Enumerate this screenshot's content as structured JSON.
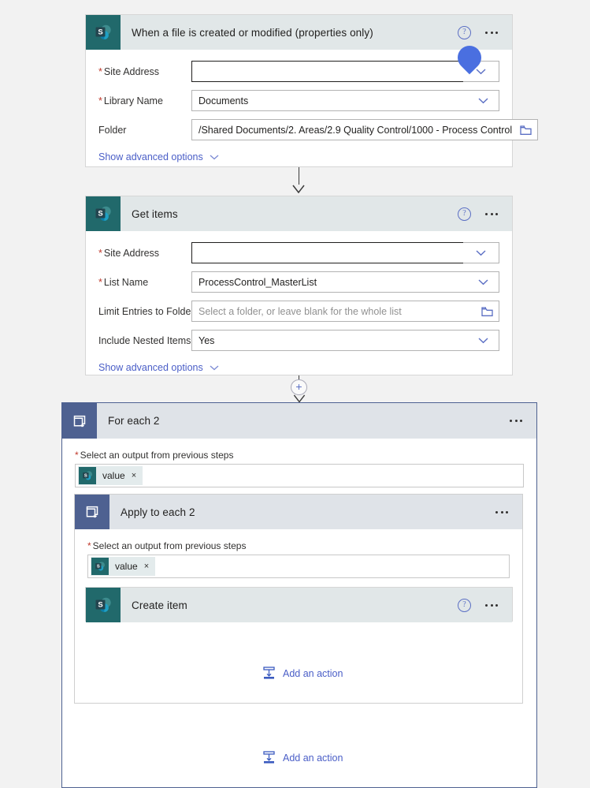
{
  "colors": {
    "page_bg": "#f2f2f2",
    "sharepoint_teal": "#21696b",
    "loop_slate": "#4e6191",
    "link_blue": "#4a5ec7",
    "required_red": "#c0392b",
    "cursor_blue": "#4a6fe0",
    "header_gray": "#dfe3e8"
  },
  "trigger_card": {
    "icon": "sharepoint-icon",
    "title": "When a file is created or modified (properties only)",
    "help_icon": "help-icon",
    "menu_icon": "ellipsis-icon",
    "fields": [
      {
        "label": "Site Address",
        "required": true,
        "value": "",
        "placeholder": "",
        "control": "combobox",
        "focused": true
      },
      {
        "label": "Library Name",
        "required": true,
        "value": "Documents",
        "placeholder": "",
        "control": "dropdown",
        "focused": false
      },
      {
        "label": "Folder",
        "required": false,
        "value": "/Shared Documents/2. Areas/2.9 Quality Control/1000 - Process Control",
        "placeholder": "",
        "control": "folderpicker",
        "focused": false
      }
    ],
    "advanced_label": "Show advanced options"
  },
  "get_items_card": {
    "icon": "sharepoint-icon",
    "title": "Get items",
    "help_icon": "help-icon",
    "menu_icon": "ellipsis-icon",
    "fields": [
      {
        "label": "Site Address",
        "required": true,
        "value": "",
        "placeholder": "",
        "control": "combobox",
        "focused": true
      },
      {
        "label": "List Name",
        "required": true,
        "value": "ProcessControl_MasterList",
        "placeholder": "",
        "control": "dropdown",
        "focused": false
      },
      {
        "label": "Limit Entries to Folder",
        "required": false,
        "value": "",
        "placeholder": "Select a folder, or leave blank for the whole list",
        "control": "folderpicker",
        "focused": false
      },
      {
        "label": "Include Nested Items",
        "required": false,
        "value": "Yes",
        "placeholder": "",
        "control": "dropdown",
        "focused": false
      }
    ],
    "advanced_label": "Show advanced options"
  },
  "foreach_outer": {
    "icon": "loop-icon",
    "title": "For each 2",
    "menu_icon": "ellipsis-icon",
    "output_label": "Select an output from previous steps",
    "output_required": true,
    "token": {
      "icon": "sharepoint-icon",
      "text": "value",
      "remove": "×"
    },
    "add_action_label": "Add an action"
  },
  "foreach_inner": {
    "icon": "loop-icon",
    "title": "Apply to each 2",
    "menu_icon": "ellipsis-icon",
    "output_label": "Select an output from previous steps",
    "output_required": true,
    "token": {
      "icon": "sharepoint-icon",
      "text": "value",
      "remove": "×"
    },
    "add_action_label": "Add an action"
  },
  "create_item_card": {
    "icon": "sharepoint-icon",
    "title": "Create item",
    "help_icon": "help-icon",
    "menu_icon": "ellipsis-icon"
  },
  "connectors": {
    "insert_icon": "plus-icon",
    "arrow_icon": "arrow-down-icon"
  }
}
